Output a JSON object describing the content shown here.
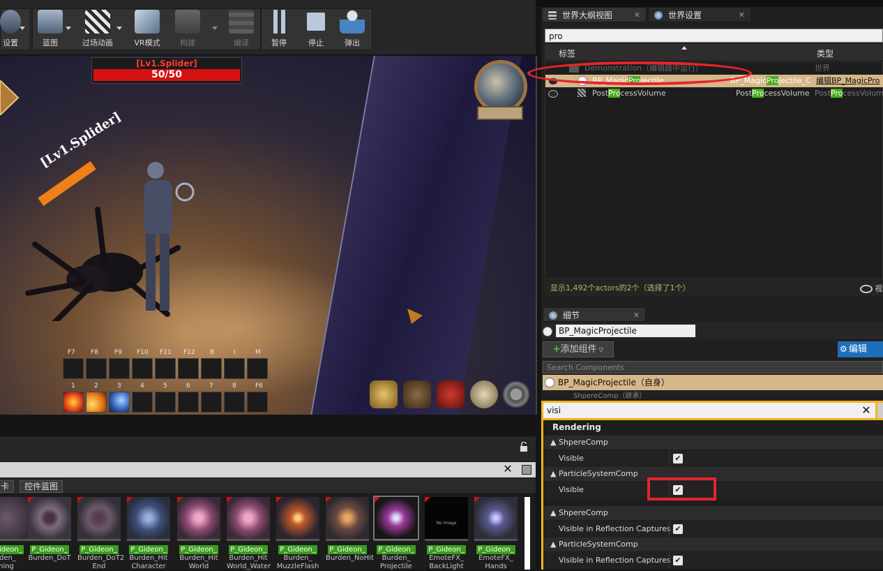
{
  "toolbar": {
    "items": [
      {
        "label": "设置",
        "enabled": true
      },
      {
        "label": "蓝图",
        "enabled": true
      },
      {
        "label": "过场动画",
        "enabled": true
      },
      {
        "label": "VR模式",
        "enabled": true
      },
      {
        "label": "构建",
        "enabled": false
      },
      {
        "label": "编译",
        "enabled": false
      },
      {
        "label": "暂停",
        "enabled": true
      },
      {
        "label": "停止",
        "enabled": true
      },
      {
        "label": "弹出",
        "enabled": true
      }
    ]
  },
  "game_hud": {
    "target_name": "[Lv1.Splider]",
    "target_hp": "50/50",
    "enemy_tag": "[Lv1.Splider]",
    "hotkeys_top": [
      "F7",
      "F8",
      "F9",
      "F10",
      "F11",
      "F12",
      "B",
      "I",
      "M"
    ],
    "hotkeys_bottom": [
      "1",
      "2",
      "3",
      "4",
      "5",
      "6",
      "7",
      "8",
      "F6"
    ]
  },
  "content_browser": {
    "tabs": [
      "卡",
      "控件蓝图"
    ],
    "close_glyph": "✕",
    "assets": [
      {
        "line1": "_Gideon_",
        "line2": "rden_",
        "line3": "hing"
      },
      {
        "line1": "P_Gideon_",
        "line2": "Burden_DoT",
        "line3": ""
      },
      {
        "line1": "P_Gideon_",
        "line2": "Burden_DoT2",
        "line3": "End"
      },
      {
        "line1": "P_Gideon_",
        "line2": "Burden_Hit",
        "line3": "Character"
      },
      {
        "line1": "P_Gideon_",
        "line2": "Burden_Hit",
        "line3": "World"
      },
      {
        "line1": "P_Gideon_",
        "line2": "Burden_Hit",
        "line3": "World_Water"
      },
      {
        "line1": "P_Gideon_",
        "line2": "Burden_",
        "line3": "MuzzleFlash"
      },
      {
        "line1": "P_Gideon_",
        "line2": "Burden_NoHit",
        "line3": ""
      },
      {
        "line1": "P_Gideon_",
        "line2": "Burden_",
        "line3": "Projectile"
      },
      {
        "line1": "P_Gideon_",
        "line2": "EmoteFX_",
        "line3": "BackLight"
      },
      {
        "line1": "P_Gideon_",
        "line2": "EmoteFX_",
        "line3": "Hands"
      }
    ],
    "no_image_label": "No Image"
  },
  "outliner": {
    "tab_title": "世界大纲视图",
    "settings_tab_title": "世界设置",
    "search_value": "pro",
    "col_label": "标签",
    "col_type": "类型",
    "world_row": {
      "label": "Demonstration（编辑器中运行）",
      "type": "世界"
    },
    "rows": [
      {
        "pre": "BP_Magic",
        "hl": "Pro",
        "post": "jectile",
        "type_pre": "BP_Magic",
        "type_hl": "Pro",
        "type_post": "jectile_C",
        "action": "编辑BP_MagicPro"
      },
      {
        "pre": "Post",
        "hl": "Pro",
        "post": "cessVolume",
        "type_pre": "Post",
        "type_hl": "Pro",
        "type_post": "cessVolume",
        "action_pre": "Post",
        "action_hl": "Pro",
        "action_post": "cessVolum"
      }
    ],
    "status": "显示1,492个actors的2个（选择了1个）",
    "view_options": "视"
  },
  "details": {
    "tab_title": "细节",
    "actor_name": "BP_MagicProjectile",
    "add_component": "添加组件",
    "edit_blueprint": "编辑",
    "search_components_placeholder": "Search Components",
    "self_component": "BP_MagicProjectile（自身）",
    "partial_component": "ShpereComp（继承）",
    "property_search": "visi",
    "category": "Rendering",
    "groups": [
      {
        "name": "ShpereComp",
        "prop": "Visible"
      },
      {
        "name": "ParticleSystemComp",
        "prop": "Visible"
      },
      {
        "name": "ShpereComp",
        "prop": "Visible in Reflection Captures"
      },
      {
        "name": "ParticleSystemComp",
        "prop": "Visible in Reflection Captures"
      }
    ]
  },
  "colors": {
    "accent_orange": "#f4b31c",
    "selection": "#d6b78a",
    "highlight_green": "#48ab1c",
    "annotation_red": "#e8232c",
    "blueprint_blue": "#1d6fb9"
  }
}
